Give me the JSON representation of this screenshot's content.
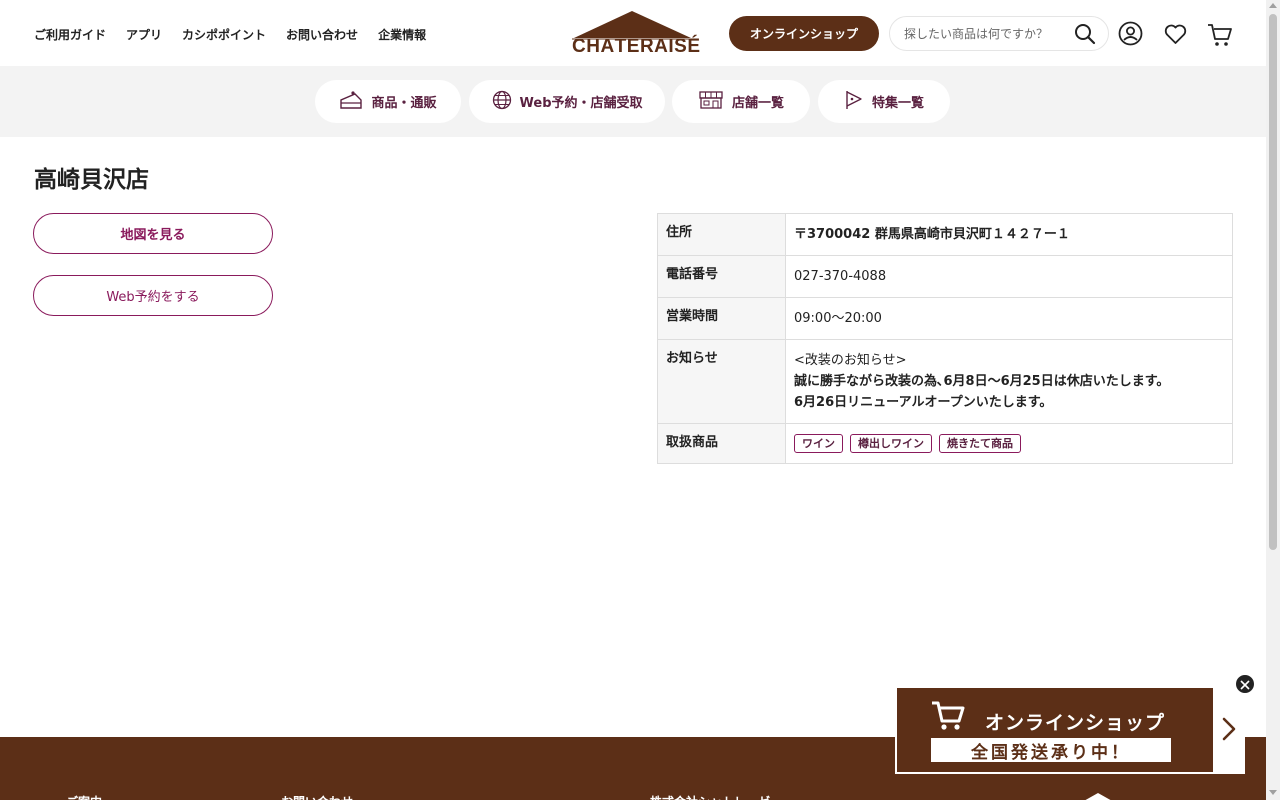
{
  "header": {
    "nav": [
      {
        "label": "ご利用ガイド"
      },
      {
        "label": "アプリ"
      },
      {
        "label": "カシポポイント"
      },
      {
        "label": "お問い合わせ"
      },
      {
        "label": "企業情報"
      }
    ],
    "logo_text": "CHÂTERAISÉ",
    "shop_button": "オンラインショップ",
    "search_placeholder": "探したい商品は何ですか？"
  },
  "categories": [
    {
      "label": "商品・通販",
      "icon": "cake-icon"
    },
    {
      "label": "Web予約・店舗受取",
      "icon": "globe-icon"
    },
    {
      "label": "店舗一覧",
      "icon": "store-icon"
    },
    {
      "label": "特集一覧",
      "icon": "flag-icon"
    }
  ],
  "store": {
    "title": "高崎貝沢店",
    "map_button": "地図を見る",
    "reserve_button": "Web予約をする",
    "info": {
      "address_label": "住所",
      "address_value": "〒3700042 群馬県高崎市貝沢町１４２７ー１",
      "phone_label": "電話番号",
      "phone_value": "027-370-4088",
      "hours_label": "営業時間",
      "hours_value": "09:00〜20:00",
      "notice_label": "お知らせ",
      "notice_lines": [
        "<改装のお知らせ>",
        "誠に勝手ながら改装の為､6月8日〜6月25日は休店いたします。",
        "6月26日リニューアルオープンいたします。"
      ],
      "products_label": "取扱商品",
      "products": [
        "ワイン",
        "樽出しワイン",
        "焼きたて商品"
      ]
    }
  },
  "banner": {
    "title": "オンラインショップ",
    "subtitle": "全国発送承り中！"
  },
  "footer": {
    "columns": [
      "ご案内",
      "お問い合わせ",
      "株式会社シャトレーゼ"
    ]
  },
  "colors": {
    "brand_brown": "#5c2f17",
    "accent_purple": "#8a1a5c"
  }
}
